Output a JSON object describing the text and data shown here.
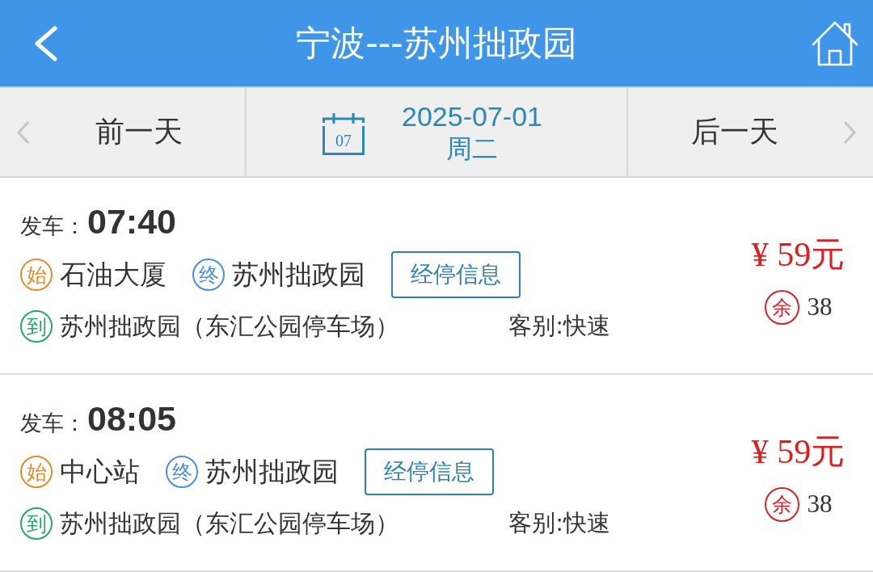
{
  "header": {
    "title": "宁波---苏州拙政园"
  },
  "date_bar": {
    "prev_label": "前一天",
    "calendar_day": "07",
    "date": "2025-07-01",
    "weekday": "周二",
    "next_label": "后一天"
  },
  "trips": [
    {
      "depart_label": "发车：",
      "time": "07:40",
      "stops": [
        {
          "kind": "origin",
          "badge": "始",
          "name": "石油大厦"
        },
        {
          "kind": "terminal",
          "badge": "终",
          "name": "苏州拙政园"
        }
      ],
      "stops_button": "经停信息",
      "arrival": {
        "kind": "arrival",
        "badge": "到",
        "name": "苏州拙政园（东汇公园停车场）"
      },
      "category": "客别:快速",
      "price": "¥ 59元",
      "seats_badge": "余",
      "seats": "38"
    },
    {
      "depart_label": "发车：",
      "time": "08:05",
      "stops": [
        {
          "kind": "origin",
          "badge": "始",
          "name": "中心站"
        },
        {
          "kind": "terminal",
          "badge": "终",
          "name": "苏州拙政园"
        }
      ],
      "stops_button": "经停信息",
      "arrival": {
        "kind": "arrival",
        "badge": "到",
        "name": "苏州拙政园（东汇公园停车场）"
      },
      "category": "客别:快速",
      "price": "¥ 59元",
      "seats_badge": "余",
      "seats": "38"
    }
  ]
}
